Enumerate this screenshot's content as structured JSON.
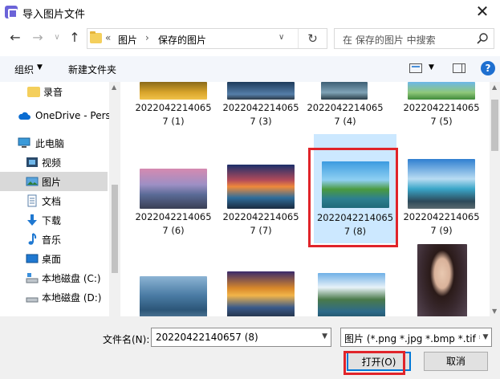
{
  "window": {
    "title": "导入图片文件"
  },
  "nav": {
    "back": "←",
    "forward": "→",
    "recent": "∨",
    "up": "↑"
  },
  "address": {
    "overflow": "«",
    "sep": "›",
    "crumbs": [
      "图片",
      "保存的图片"
    ],
    "refresh": "↻"
  },
  "search": {
    "placeholder": "在 保存的图片 中搜索"
  },
  "toolbar": {
    "organize": "组织",
    "new_folder": "新建文件夹",
    "help": "?"
  },
  "sidebar": {
    "items": [
      {
        "label": "录音",
        "icon": "folder-icon"
      },
      {
        "label": "OneDrive - Pers",
        "icon": "cloud-icon"
      },
      {
        "label": "此电脑",
        "icon": "computer-icon"
      },
      {
        "label": "视频",
        "icon": "video-icon"
      },
      {
        "label": "图片",
        "icon": "picture-icon",
        "selected": true
      },
      {
        "label": "文档",
        "icon": "document-icon"
      },
      {
        "label": "下载",
        "icon": "download-icon"
      },
      {
        "label": "音乐",
        "icon": "music-icon"
      },
      {
        "label": "桌面",
        "icon": "desktop-icon"
      },
      {
        "label": "本地磁盘 (C:)",
        "icon": "drive-icon"
      },
      {
        "label": "本地磁盘 (D:)",
        "icon": "drive-icon"
      }
    ]
  },
  "files": [
    {
      "line1": "2022042214065",
      "line2": "7 (1)"
    },
    {
      "line1": "2022042214065",
      "line2": "7 (3)"
    },
    {
      "line1": "2022042214065",
      "line2": "7 (4)"
    },
    {
      "line1": "2022042214065",
      "line2": "7 (5)"
    },
    {
      "line1": "2022042214065",
      "line2": "7 (6)"
    },
    {
      "line1": "2022042214065",
      "line2": "7 (7)"
    },
    {
      "line1": "2022042214065",
      "line2": "7 (8)",
      "selected": true
    },
    {
      "line1": "2022042214065",
      "line2": "7 (9)"
    }
  ],
  "bottom": {
    "filename_label": "文件名(N):",
    "filename_value": "20220422140657 (8)",
    "filetype_value": "图片 (*.png *.jpg *.bmp *.tif *",
    "open_button": "打开(O)",
    "cancel_button": "取消"
  },
  "colors": {
    "accent": "#0078d7",
    "highlight": "#e0242a",
    "selection": "#cce8ff"
  }
}
